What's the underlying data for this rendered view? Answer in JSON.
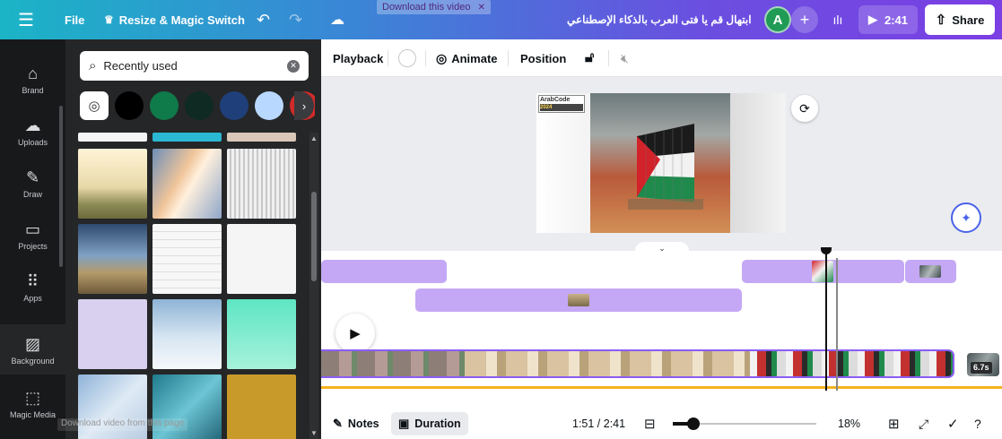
{
  "topbar": {
    "menu_icon": "hamburger-icon",
    "file_label": "File",
    "resize_label": "Resize & Magic Switch",
    "download_ghost": "Download this video",
    "title": "ابتهال قم يا فتى العرب بالذكاء الإصطناعي",
    "avatar_letter": "A",
    "play_time": "2:41",
    "share_label": "Share"
  },
  "rail": {
    "items": [
      {
        "label": "Brand",
        "icon": "brand-icon"
      },
      {
        "label": "Uploads",
        "icon": "upload-cloud-icon"
      },
      {
        "label": "Draw",
        "icon": "draw-pen-icon"
      },
      {
        "label": "Projects",
        "icon": "folder-icon"
      },
      {
        "label": "Apps",
        "icon": "apps-grid-icon"
      },
      {
        "label": "Background",
        "icon": "background-hatch-icon"
      },
      {
        "label": "Magic Media",
        "icon": "magic-media-icon"
      }
    ]
  },
  "panel": {
    "search_value": "Recently used",
    "download_ghost": "Download video from this page",
    "swatch_colors": [
      "#000000",
      "#0f7a4a",
      "#0f2a22",
      "#1f3f7a",
      "#b8d8ff",
      "#d12a2a"
    ]
  },
  "editor_toolbar": {
    "playback": "Playback",
    "animate": "Animate",
    "position": "Position"
  },
  "canvas": {
    "logo_text": "ArabCode",
    "logo_year": "2024"
  },
  "timeline": {
    "end_badge": "6.7s"
  },
  "bottombar": {
    "notes": "Notes",
    "duration": "Duration",
    "time": "1:51 / 2:41",
    "zoom": "18%"
  }
}
